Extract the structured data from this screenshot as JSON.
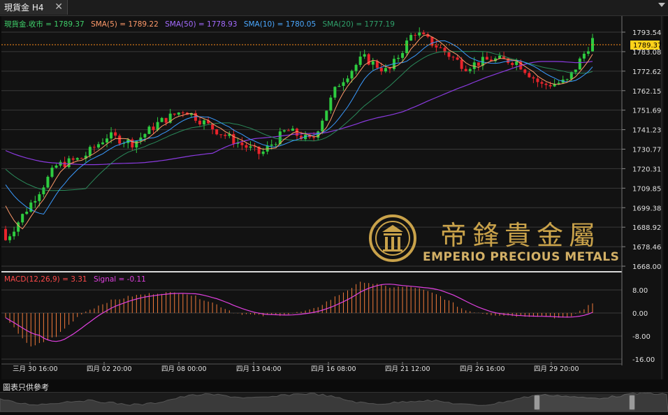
{
  "tab": {
    "title": "現貨金 H4"
  },
  "legend": {
    "main": "現貨金.收市 = 1789.37",
    "sma5": "SMA(5) = 1789.22",
    "sma50": "SMA(50) = 1778.93",
    "sma10": "SMA(10) = 1780.05",
    "sma20": "SMA(20) = 1777.19"
  },
  "macd_legend": {
    "macd": "MACD(12,26,9) = 3.31",
    "signal": "Signal = -0.11"
  },
  "price_tag": "1789.37",
  "price_axis": [
    "1793.54",
    "1783.08",
    "1772.62",
    "1762.15",
    "1751.69",
    "1741.23",
    "1730.77",
    "1720.31",
    "1709.85",
    "1699.38",
    "1688.92",
    "1678.46",
    "1668.00"
  ],
  "macd_axis": [
    "8.00",
    "0.00",
    "-8.00",
    "-16.00"
  ],
  "time_axis": [
    "三月 30 16:00",
    "四月 02 20:00",
    "四月 08 00:00",
    "四月 13 04:00",
    "四月 16 08:00",
    "四月 21 12:00",
    "四月 26 16:00",
    "四月 29 20:00"
  ],
  "caption": "圖表只供參考",
  "logo": {
    "chinese": "帝鋒貴金屬",
    "english": "EMPERIO PRECIOUS METALS"
  },
  "colors": {
    "up": "#2ecc40",
    "down": "#e8242b",
    "sma5": "#ff9a6a",
    "sma10": "#3a9bff",
    "sma20": "#2a8a5a",
    "sma50": "#8a3adf",
    "macd_hist": "#f07a3a",
    "signal": "#e040e0",
    "price_line": "#ff8c1a",
    "logo": "#c9a24a"
  },
  "chart_data": {
    "type": "candlestick",
    "symbol": "現貨金",
    "timeframe": "H4",
    "ylim": [
      1668.0,
      1793.54
    ],
    "close_points": [
      [
        "三月 30 16:00",
        1682
      ],
      [
        "三月 31",
        1702
      ],
      [
        "四月 01",
        1722
      ],
      [
        "四月 02 20:00",
        1726
      ],
      [
        "四月 05",
        1738
      ],
      [
        "四月 06",
        1734
      ],
      [
        "四月 07",
        1745
      ],
      [
        "四月 08 00:00",
        1752
      ],
      [
        "四月 09",
        1743
      ],
      [
        "四月 12",
        1735
      ],
      [
        "四月 13 04:00",
        1728
      ],
      [
        "四月 14",
        1741
      ],
      [
        "四月 15",
        1735
      ],
      [
        "四月 16 08:00",
        1765
      ],
      [
        "四月 19",
        1780
      ],
      [
        "四月 20",
        1772
      ],
      [
        "四月 21 12:00",
        1794
      ],
      [
        "四月 22",
        1785
      ],
      [
        "四月 23",
        1775
      ],
      [
        "四月 26 16:00",
        1779
      ],
      [
        "四月 27",
        1778
      ],
      [
        "四月 28",
        1765
      ],
      [
        "四月 29 20:00",
        1767
      ],
      [
        "四月 30",
        1789.37
      ]
    ],
    "macd_points": [
      -2,
      -12,
      -8,
      0,
      4,
      6,
      7,
      7,
      4,
      0,
      -1,
      -0.5,
      1,
      6,
      11,
      9,
      9,
      6,
      1,
      -0.5,
      -1,
      -1,
      -2,
      3.31
    ]
  }
}
